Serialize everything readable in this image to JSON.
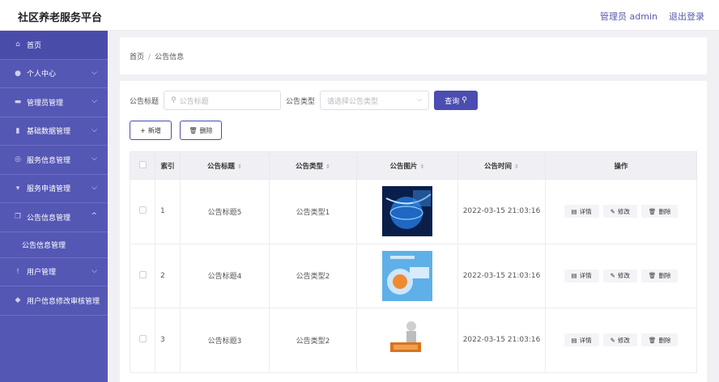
{
  "header": {
    "title": "社区养老服务平台",
    "user_label": "管理员 admin",
    "logout_label": "退出登录"
  },
  "sidebar": {
    "items": [
      {
        "label": "首页",
        "icon": "home-icon"
      },
      {
        "label": "个人中心",
        "icon": "user-icon"
      },
      {
        "label": "管理员管理",
        "icon": "bank-icon"
      },
      {
        "label": "基础数据管理",
        "icon": "bar-chart-icon"
      },
      {
        "label": "服务信息管理",
        "icon": "service-icon"
      },
      {
        "label": "服务申请管理",
        "icon": "apply-icon"
      },
      {
        "label": "公告信息管理",
        "icon": "copy-icon"
      },
      {
        "label": "用户管理",
        "icon": "microphone-icon"
      },
      {
        "label": "用户信息修改审核管理",
        "icon": "location-icon"
      }
    ],
    "sub_item": "公告信息管理"
  },
  "breadcrumb": {
    "home": "首页",
    "sep": "/",
    "current": "公告信息"
  },
  "search": {
    "title_label": "公告标题",
    "title_placeholder": "公告标题",
    "type_label": "公告类型",
    "type_placeholder": "请选择公告类型",
    "query_label": "查询"
  },
  "actions": {
    "add_label": "新增",
    "delete_label": "删除"
  },
  "table": {
    "headers": {
      "index": "索引",
      "title": "公告标题",
      "type": "公告类型",
      "image": "公告图片",
      "time": "公告时间",
      "ops": "操作"
    },
    "rows": [
      {
        "index": "1",
        "title": "公告标题5",
        "type": "公告类型1",
        "time": "2022-03-15 21:03:16"
      },
      {
        "index": "2",
        "title": "公告标题4",
        "type": "公告类型2",
        "time": "2022-03-15 21:03:16"
      },
      {
        "index": "3",
        "title": "公告标题3",
        "type": "公告类型2",
        "time": "2022-03-15 21:03:16"
      }
    ],
    "op_labels": {
      "detail": "详情",
      "edit": "修改",
      "delete": "删除"
    }
  },
  "colors": {
    "sidebar_bg": "#5557b4",
    "accent": "#4b4db0"
  }
}
